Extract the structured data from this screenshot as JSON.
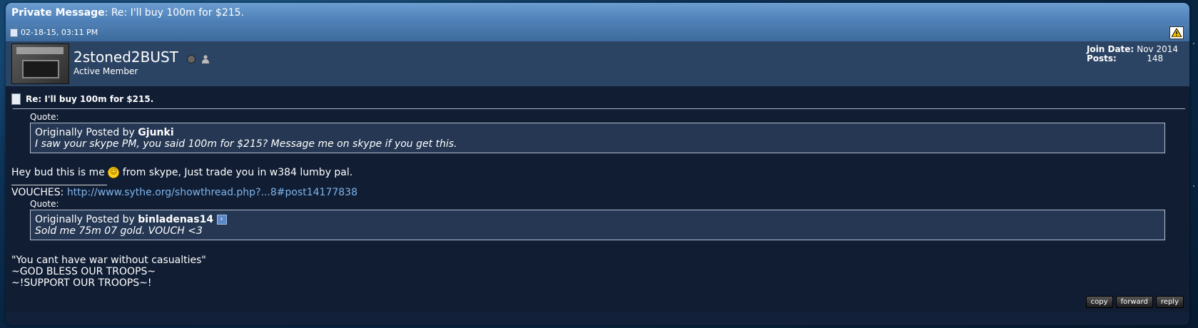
{
  "window": {
    "title_prefix": "Private Message",
    "title_suffix": ": Re: I'll buy 100m for $215."
  },
  "post": {
    "datetime": "02-18-15, 03:11 PM",
    "user": {
      "name": "2stoned2BUST",
      "title": "Active Member",
      "join_date_label": "Join Date:",
      "join_date_value": "Nov 2014",
      "posts_label": "Posts:",
      "posts_value": "148"
    },
    "title": "Re: I'll buy 100m for $215.",
    "quote1": {
      "label": "Quote:",
      "posted_by": "Originally Posted by",
      "author": "Gjunki",
      "message": "I saw your skype PM, you said 100m for $215? Message me on skype if you get this."
    },
    "body_before_smiley": "Hey bud this is me",
    "body_after_smiley": "from skype, Just trade you in w384 lumby pal.",
    "signature": {
      "vouches_label": "VOUCHES:",
      "vouches_link": "http://www.sythe.org/showthread.php?...8#post14177838",
      "quote": {
        "label": "Quote:",
        "posted_by": "Originally Posted by",
        "author": "binladenas14",
        "message": "Sold me 75m 07 gold. VOUCH <3"
      },
      "line1": "\"You cant have war without casualties\"",
      "line2": "~GOD BLESS OUR TROOPS~",
      "line3": "~!SUPPORT OUR TROOPS~!"
    },
    "buttons": {
      "copy": "copy",
      "forward": "forward",
      "reply": "reply"
    }
  }
}
